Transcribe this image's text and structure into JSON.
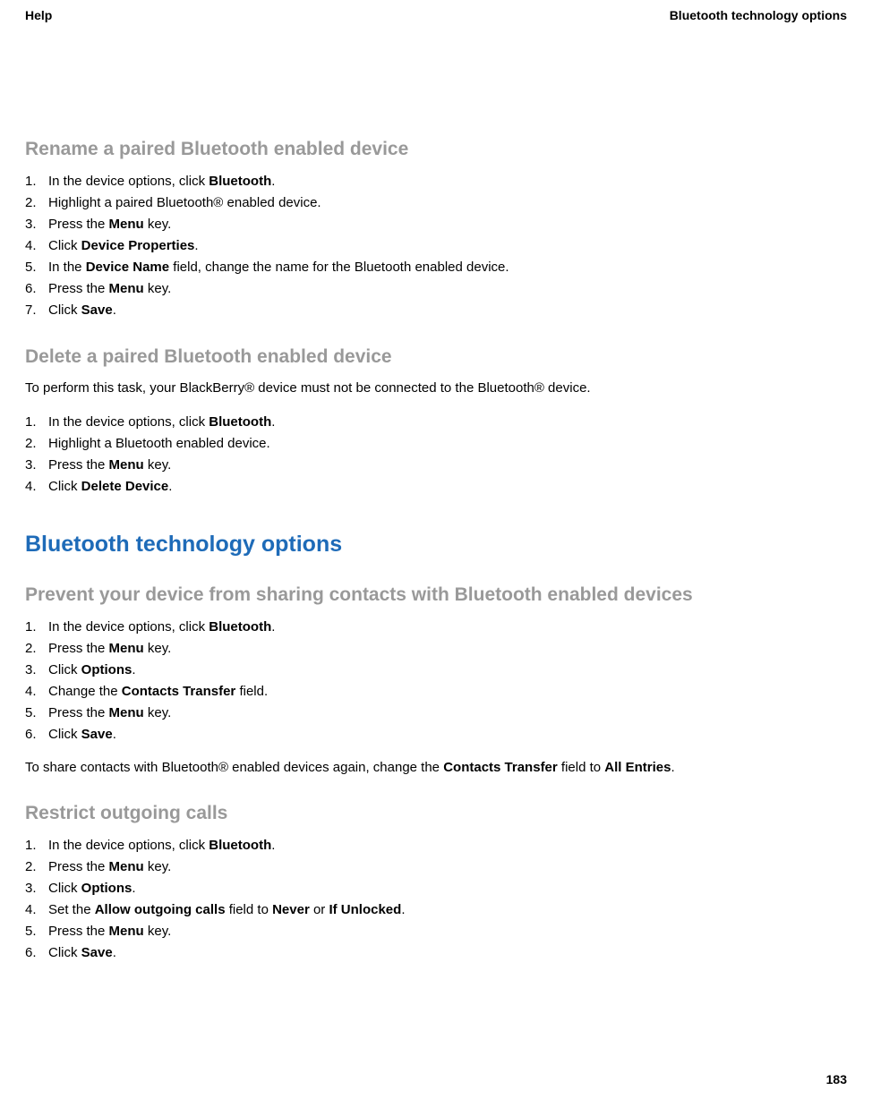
{
  "header": {
    "left": "Help",
    "right": "Bluetooth technology options"
  },
  "page_number": "183",
  "sections": {
    "rename": {
      "heading": "Rename a paired Bluetooth enabled device",
      "steps": [
        {
          "pre": "In the device options, click ",
          "bold": "Bluetooth",
          "post": "."
        },
        {
          "pre": "Highlight a paired Bluetooth® enabled device.",
          "bold": "",
          "post": ""
        },
        {
          "pre": "Press the ",
          "bold": "Menu",
          "post": " key."
        },
        {
          "pre": "Click ",
          "bold": "Device Properties",
          "post": "."
        },
        {
          "pre": "In the ",
          "bold": "Device Name",
          "post": " field, change the name for the Bluetooth enabled device."
        },
        {
          "pre": "Press the ",
          "bold": "Menu",
          "post": " key."
        },
        {
          "pre": "Click ",
          "bold": "Save",
          "post": "."
        }
      ]
    },
    "delete": {
      "heading": "Delete a paired Bluetooth enabled device",
      "intro": "To perform this task, your BlackBerry® device must not be connected to the Bluetooth® device.",
      "steps": [
        {
          "pre": "In the device options, click ",
          "bold": "Bluetooth",
          "post": "."
        },
        {
          "pre": "Highlight a Bluetooth enabled device.",
          "bold": "",
          "post": ""
        },
        {
          "pre": "Press the ",
          "bold": "Menu",
          "post": " key."
        },
        {
          "pre": "Click ",
          "bold": "Delete Device",
          "post": "."
        }
      ]
    },
    "main_heading": "Bluetooth technology options",
    "prevent": {
      "heading": "Prevent your device from sharing contacts with Bluetooth enabled devices",
      "steps": [
        {
          "pre": "In the device options, click ",
          "bold": "Bluetooth",
          "post": "."
        },
        {
          "pre": "Press the ",
          "bold": "Menu",
          "post": " key."
        },
        {
          "pre": "Click ",
          "bold": "Options",
          "post": "."
        },
        {
          "pre": "Change the ",
          "bold": "Contacts Transfer",
          "post": " field."
        },
        {
          "pre": "Press the ",
          "bold": "Menu",
          "post": " key."
        },
        {
          "pre": "Click ",
          "bold": "Save",
          "post": "."
        }
      ],
      "outro_pre": "To share contacts with Bluetooth® enabled devices again, change the ",
      "outro_bold1": "Contacts Transfer",
      "outro_mid": " field to ",
      "outro_bold2": "All Entries",
      "outro_post": "."
    },
    "restrict": {
      "heading": "Restrict outgoing calls",
      "steps": [
        {
          "pre": "In the device options, click ",
          "bold": "Bluetooth",
          "post": "."
        },
        {
          "pre": "Press the ",
          "bold": "Menu",
          "post": " key."
        },
        {
          "pre": "Click ",
          "bold": "Options",
          "post": "."
        },
        {
          "pre": "Set the ",
          "bold": "Allow outgoing calls",
          "post_mid": " field to ",
          "bold2": "Never",
          "post_mid2": " or ",
          "bold3": "If Unlocked",
          "post": "."
        },
        {
          "pre": "Press the ",
          "bold": "Menu",
          "post": " key."
        },
        {
          "pre": "Click ",
          "bold": "Save",
          "post": "."
        }
      ]
    }
  }
}
